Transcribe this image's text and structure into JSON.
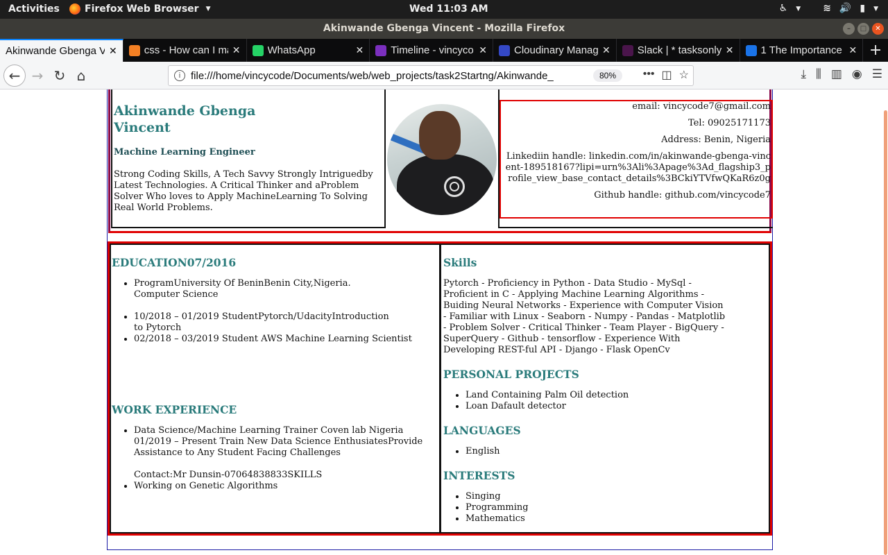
{
  "topbar": {
    "activities": "Activities",
    "app_name": "Firefox Web Browser",
    "clock": "Wed 11:03 AM"
  },
  "window": {
    "title": "Akinwande Gbenga Vincent - Mozilla Firefox"
  },
  "tabs": [
    {
      "label": "Akinwande Gbenga V",
      "active": true,
      "favicon_color": "#ffffff"
    },
    {
      "label": "css - How can I ma",
      "active": false,
      "favicon_color": "#f48024"
    },
    {
      "label": "WhatsApp",
      "active": false,
      "favicon_color": "#25d366"
    },
    {
      "label": "Timeline - vincyco",
      "active": false,
      "favicon_color": "#7b2fbe"
    },
    {
      "label": "Cloudinary Manag",
      "active": false,
      "favicon_color": "#3448c5"
    },
    {
      "label": "Slack | * tasksonly",
      "active": false,
      "favicon_color": "#4a154b"
    },
    {
      "label": "1 The Importance",
      "active": false,
      "favicon_color": "#1a73e8"
    }
  ],
  "navbar": {
    "url": "file:///home/vincycode/Documents/web/web_projects/task2Startng/Akinwande_",
    "zoom": "80%"
  },
  "resume": {
    "name_line1": "Akinwande Gbenga",
    "name_line2": "Vincent",
    "role": "Machine Learning Engineer",
    "summary": "Strong Coding Skills, A Tech Savvy Strongly Intriguedby Latest Technologies. A Critical Thinker and aProblem Solver Who loves to Apply MachineLearning To Solving Real World Problems.",
    "contact": {
      "email": "email: vincycode7@gmail.com",
      "tel": "Tel: 09025171173",
      "address": "Address: Benin, Nigeria",
      "linkedin": "Linkediin handle: linkedin.com/in/akinwande-gbenga-vincent-189518167?lipi=urn%3Ali%3Apage%3Ad_flagship3_profile_view_base_contact_details%3BCkiYTVfwQKaR6z0g",
      "github": "Github handle: github.com/vincycode7"
    },
    "education": {
      "heading": "EDUCATION07/2016",
      "item1_line1": "ProgramUniversity Of BeninBenin City,Nigeria.",
      "item1_line2": "Computer Science",
      "item2": "10/2018 – 01/2019 StudentPytorch/UdacityIntroduction to Pytorch",
      "item3": "02/2018 – 03/2019 Student AWS Machine Learning Scientist"
    },
    "work": {
      "heading": "WORK EXPERIENCE",
      "item1_text": "Data Science/Machine Learning Trainer Coven lab Nigeria 01/2019 – Present Train New Data Science EnthusiatesProvide Assistance to Any Student Facing Challenges",
      "item1_contact": "Contact:Mr Dunsin-07064838833SKILLS",
      "item2": "Working on Genetic Algorithms"
    },
    "skills": {
      "heading": "Skills",
      "text": "Pytorch - Proficiency in Python - Data Studio - MySql - Proficient in C - Applying Machine Learning Algorithms - Buiding Neural Networks - Experience with Computer Vision - Familiar with Linux - Seaborn - Numpy - Pandas - Matplotlib - Problem Solver - Critical Thinker - Team Player - BigQuery - SuperQuery - Github - tensorflow - Experience With Developing REST-ful API - Django - Flask OpenCv"
    },
    "projects": {
      "heading": "PERSONAL PROJECTS",
      "items": [
        "Land Containing Palm Oil detection",
        "Loan Dafault detector"
      ]
    },
    "languages": {
      "heading": "LANGUAGES",
      "items": [
        "English"
      ]
    },
    "interests": {
      "heading": "INTERESTS",
      "items": [
        "Singing",
        "Programming",
        "Mathematics"
      ]
    }
  }
}
